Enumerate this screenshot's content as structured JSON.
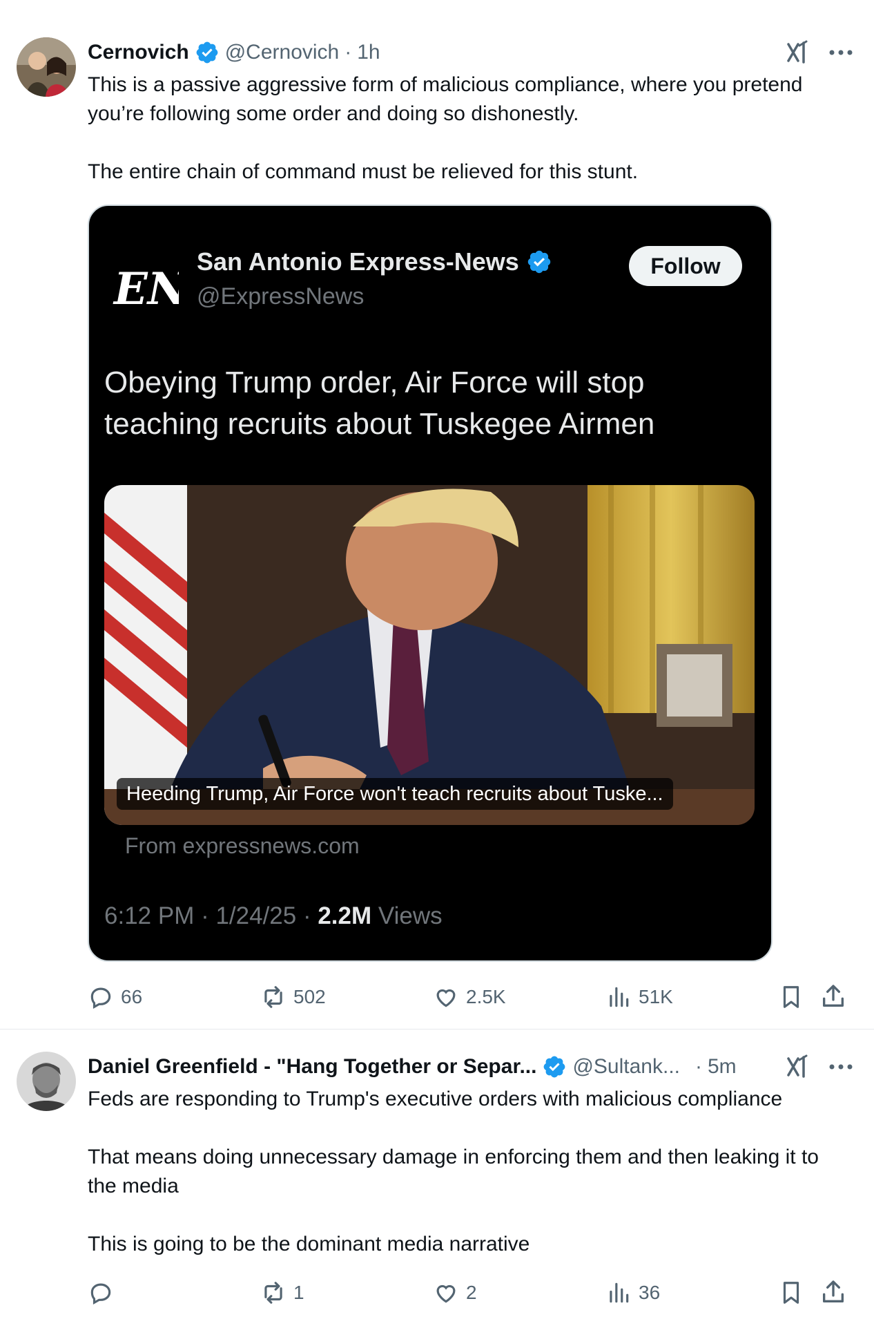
{
  "posts": [
    {
      "author_name": "Cernovich",
      "handle": "@Cernovich",
      "separator": "·",
      "time": "1h",
      "paragraphs": [
        "This is a passive aggressive form of malicious compliance, where you pretend you’re following some order and doing so dishonestly.",
        "The entire chain of command must be relieved for this stunt."
      ],
      "embed": {
        "account_name": "San Antonio Express-News",
        "account_handle": "@ExpressNews",
        "follow_label": "Follow",
        "headline": "Obeying Trump order, Air Force will stop teaching recruits about Tuskegee Airmen",
        "card_caption": "Heeding Trump, Air Force won't teach recruits about Tuske...",
        "source": "From expressnews.com",
        "timestamp": "6:12 PM · 1/24/25 · ",
        "views_count": "2.2M",
        "views_label": " Views",
        "logo_text": "EN"
      },
      "stats": {
        "replies": "66",
        "reposts": "502",
        "likes": "2.5K",
        "views": "51K"
      }
    },
    {
      "author_name": "Daniel Greenfield - \"Hang Together or Separ...",
      "handle": "@Sultank...",
      "separator": "·",
      "time": "5m",
      "paragraphs": [
        "Feds are responding to Trump's executive orders with malicious compliance",
        "That means doing unnecessary damage in enforcing them and then leaking it to the media",
        "This is going to be the dominant media narrative"
      ],
      "stats": {
        "replies": "",
        "reposts": "1",
        "likes": "2",
        "views": "36"
      }
    }
  ],
  "icons": {
    "verified": "verified-badge-icon",
    "grok": "grok-icon",
    "more": "more-icon",
    "reply": "reply-icon",
    "repost": "repost-icon",
    "like": "like-icon",
    "views": "views-icon",
    "bookmark": "bookmark-icon",
    "share": "share-icon"
  },
  "colors": {
    "verified": "#1d9bf0",
    "muted": "#536471",
    "text": "#0f1419",
    "embed_bg": "#000000"
  }
}
